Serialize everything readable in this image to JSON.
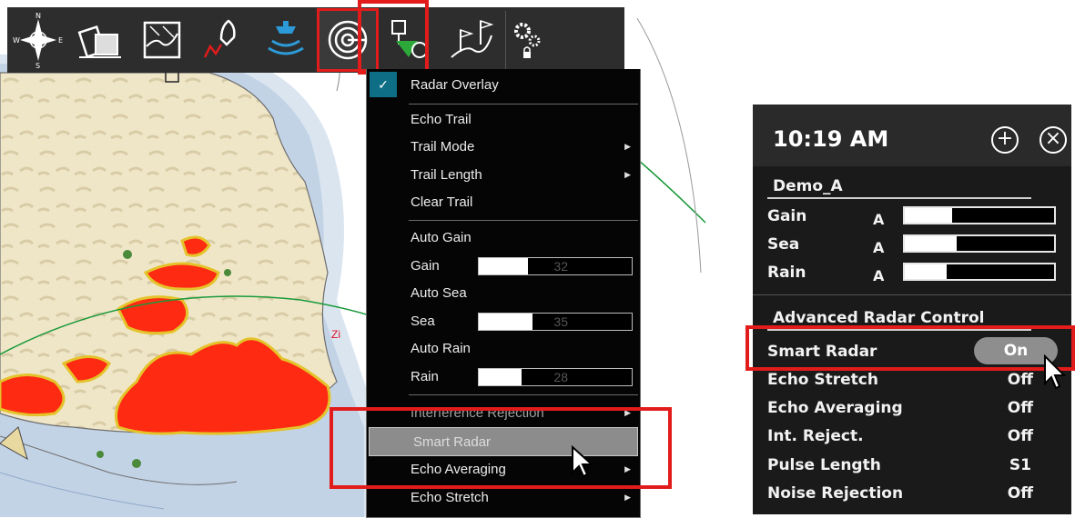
{
  "toolbar": {
    "items": [
      {
        "icon": "compass-rose-icon"
      },
      {
        "icon": "chart-layers-icon"
      },
      {
        "icon": "chart-edit-icon"
      },
      {
        "icon": "route-boat-icon"
      },
      {
        "icon": "sonar-boat-icon"
      },
      {
        "icon": "radar-icon",
        "active": true
      },
      {
        "icon": "waypoint-timer-icon"
      },
      {
        "icon": "flags-route-icon"
      },
      {
        "icon": "settings-gears-icon"
      }
    ],
    "compass_letters": {
      "n": "N",
      "s": "S",
      "e": "E",
      "w": "W"
    }
  },
  "menu": {
    "radar_overlay": {
      "label": "Radar Overlay",
      "checked": true,
      "check_glyph": "✓"
    },
    "echo_trail": {
      "label": "Echo Trail"
    },
    "trail_mode": {
      "label": "Trail Mode"
    },
    "trail_length": {
      "label": "Trail Length"
    },
    "clear_trail": {
      "label": "Clear Trail"
    },
    "auto_gain": {
      "label": "Auto Gain"
    },
    "gain": {
      "label": "Gain",
      "value": "32",
      "fraction": 0.32
    },
    "auto_sea": {
      "label": "Auto Sea"
    },
    "sea": {
      "label": "Sea",
      "value": "35",
      "fraction": 0.35
    },
    "auto_rain": {
      "label": "Auto Rain"
    },
    "rain": {
      "label": "Rain",
      "value": "28",
      "fraction": 0.28
    },
    "interference_rejection": {
      "label": "Interference Rejection"
    },
    "smart_radar": {
      "label": "Smart Radar",
      "highlighted": true
    },
    "echo_averaging": {
      "label": "Echo Averaging"
    },
    "echo_stretch": {
      "label": "Echo Stretch"
    },
    "arrow_glyph": "▶"
  },
  "map_label": "Zi",
  "panel": {
    "time": "10:19 AM",
    "add_glyph": "+",
    "close_glyph": "×",
    "device": "Demo_A",
    "gain": {
      "label": "Gain",
      "mode": "A",
      "value": "32 %",
      "fraction": 0.32
    },
    "sea": {
      "label": "Sea",
      "mode": "A",
      "value": "35 %",
      "fraction": 0.35
    },
    "rain": {
      "label": "Rain",
      "mode": "A",
      "value": "28 %",
      "fraction": 0.28
    },
    "advanced_title": "Advanced Radar Control",
    "smart_radar": {
      "label": "Smart Radar",
      "value": "On"
    },
    "echo_stretch": {
      "label": "Echo Stretch",
      "value": "Off"
    },
    "echo_averaging": {
      "label": "Echo Averaging",
      "value": "Off"
    },
    "int_reject": {
      "label": "Int. Reject.",
      "value": "Off"
    },
    "pulse_length": {
      "label": "Pulse Length",
      "value": "S1"
    },
    "noise_rejection": {
      "label": "Noise Rejection",
      "value": "Off"
    }
  },
  "colors": {
    "highlight_red": "#e21b1b",
    "radar_echo": "#ff2a12",
    "land": "#efe6c8",
    "menu_bg": "#050505",
    "check_teal": "#0e6e85"
  }
}
